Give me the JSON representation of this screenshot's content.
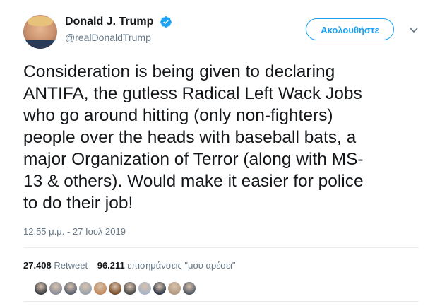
{
  "user": {
    "display_name": "Donald J. Trump",
    "handle": "@realDonaldTrump",
    "verified": true,
    "avatar_icon": "profile-photo-icon"
  },
  "follow_button_label": "Ακολουθήστε",
  "tweet_text": "Consideration is being given to declaring\nANTIFA, the gutless Radical Left Wack Jobs\nwho go around hitting (only non-fighters)\npeople over the heads with baseball bats, a\nmajor Organization of Terror (along with MS-\n13 & others). Would make it easier for police\nto do their job!",
  "timestamp": "12:55 μ.μ. - 27 Ιουλ 2019",
  "stats": {
    "retweets_count": "27.408",
    "retweets_label": "Retweet",
    "likes_count": "96.211",
    "likes_label": "επισημάνσεις \"μου αρέσει\""
  },
  "liker_avatars": [
    {
      "color": "#3b3f45"
    },
    {
      "color": "#8a8f99"
    },
    {
      "color": "#5a6270"
    },
    {
      "color": "#9aa3ad"
    },
    {
      "color": "#c08a5e"
    },
    {
      "color": "#7a4f2c"
    },
    {
      "color": "#4a4a4a"
    },
    {
      "color": "#a7b4c7"
    },
    {
      "color": "#2f3a4a"
    },
    {
      "color": "#b39b82"
    },
    {
      "color": "#525b66"
    }
  ],
  "colors": {
    "accent": "#1da1f2",
    "text": "#14171a",
    "muted": "#657786",
    "divider": "#e6ecf0"
  }
}
